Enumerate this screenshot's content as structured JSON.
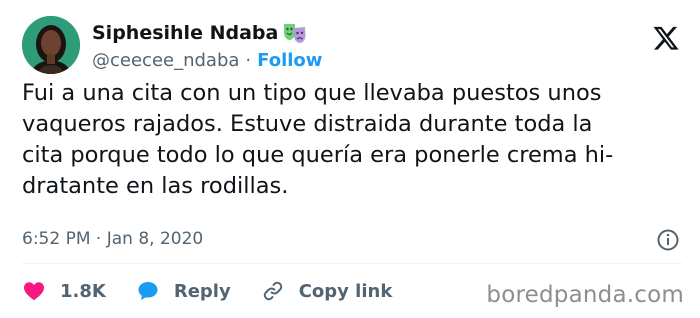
{
  "tweet": {
    "author_name": "Siphesihle Ndaba",
    "author_handle": "@ceecee_ndaba",
    "separator": "·",
    "follow_label": "Follow",
    "text": "Fui a una cita con un tipo que llevaba puestos unos\nvaqueros rajados. Estuve distraida durante toda la\ncita porque todo lo que quería era ponerle crema hi-\ndratante en las rodillas.",
    "timestamp": "6:52 PM · Jan 8, 2020"
  },
  "actions": {
    "likes_count": "1.8K",
    "reply_label": "Reply",
    "copy_link_label": "Copy link"
  },
  "watermark": "boredpanda.com",
  "icons": {
    "badge": "theater-masks-emoji",
    "logo": "x-logo-icon",
    "info": "info-icon",
    "like": "heart-icon",
    "reply": "speech-bubble-icon",
    "copy": "link-icon"
  },
  "colors": {
    "like": "#f91880",
    "follow": "#1d9bf0",
    "reply_bubble": "#1d9bf0",
    "muted": "#536471"
  }
}
